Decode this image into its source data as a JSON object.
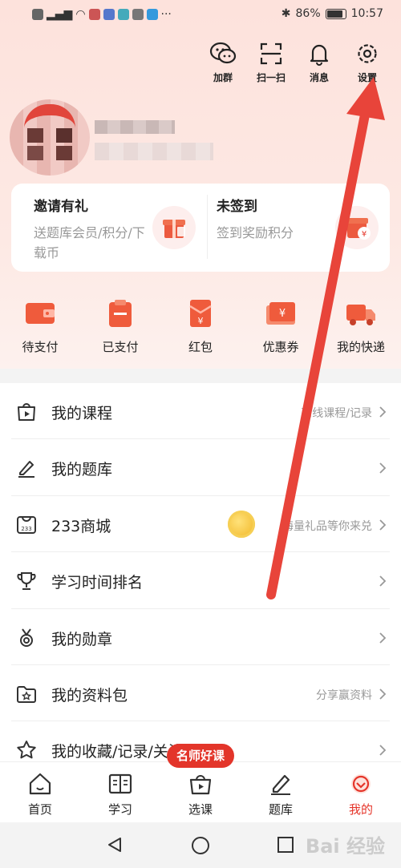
{
  "statusbar": {
    "battery": "86%",
    "time": "10:57",
    "battery_level": 0.86
  },
  "top_actions": [
    {
      "label": "加群",
      "icon": "wechat-icon"
    },
    {
      "label": "扫一扫",
      "icon": "scan-icon"
    },
    {
      "label": "消息",
      "icon": "bell-icon"
    },
    {
      "label": "设置",
      "icon": "gear-icon"
    }
  ],
  "promo": {
    "left": {
      "title": "邀请有礼",
      "subtitle": "送题库会员/积分/下载币"
    },
    "right": {
      "title": "未签到",
      "subtitle": "签到奖励积分"
    }
  },
  "orders": [
    {
      "label": "待支付",
      "icon": "wallet-icon"
    },
    {
      "label": "已支付",
      "icon": "clipboard-icon"
    },
    {
      "label": "红包",
      "icon": "red-envelope-icon"
    },
    {
      "label": "优惠券",
      "icon": "coupon-icon"
    },
    {
      "label": "我的快递",
      "icon": "truck-icon"
    }
  ],
  "menu": [
    {
      "label": "我的课程",
      "hint": "离线课程/记录",
      "icon": "course-play-icon"
    },
    {
      "label": "我的题库",
      "hint": "",
      "icon": "pencil-icon"
    },
    {
      "label": "233商城",
      "hint": "海量礼品等你来兑",
      "icon": "store-233-icon"
    },
    {
      "label": "学习时间排名",
      "hint": "",
      "icon": "trophy-icon"
    },
    {
      "label": "我的勋章",
      "hint": "",
      "icon": "medal-icon"
    },
    {
      "label": "我的资料包",
      "hint": "分享赢资料",
      "icon": "folder-star-icon"
    },
    {
      "label": "我的收藏/记录/关注",
      "hint": "",
      "icon": "star-icon"
    }
  ],
  "bubble": "名师好课",
  "tabs": [
    {
      "label": "首页",
      "icon": "home-icon"
    },
    {
      "label": "学习",
      "icon": "book-icon"
    },
    {
      "label": "选课",
      "icon": "course-bag-icon"
    },
    {
      "label": "题库",
      "icon": "pencil-icon"
    },
    {
      "label": "我的",
      "icon": "profile-icon"
    }
  ],
  "watermark": "Bai 经验",
  "colors": {
    "accent": "#e5352a",
    "background": "#fde2dc"
  }
}
